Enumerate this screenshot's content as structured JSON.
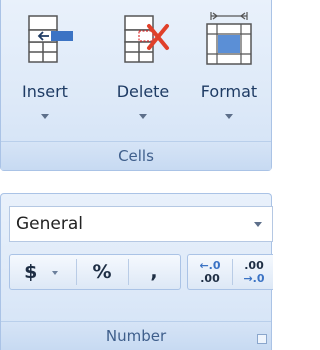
{
  "cells": {
    "insert_label": "Insert",
    "delete_label": "Delete",
    "format_label": "Format",
    "group_label": "Cells"
  },
  "number": {
    "format_value": "General",
    "currency_label": "$",
    "percent_label": "%",
    "comma_label": ",",
    "increase_decimal_top": "←.0",
    "increase_decimal_bottom": ".00",
    "decrease_decimal_top": ".00",
    "decrease_decimal_bottom": "→.0",
    "group_label": "Number"
  },
  "colors": {
    "accent_blue": "#3b73c4",
    "delete_red": "#e0402a"
  }
}
